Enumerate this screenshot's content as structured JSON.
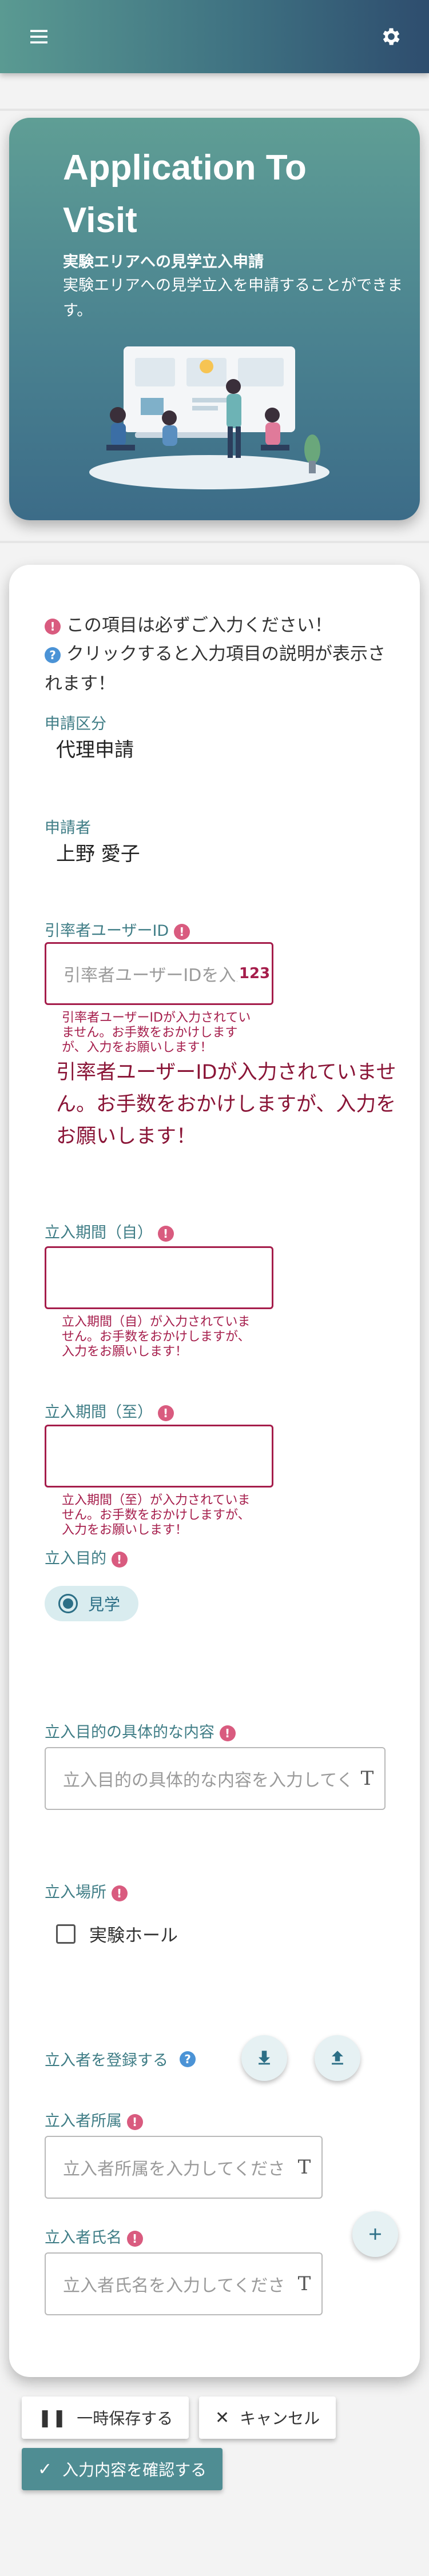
{
  "header": {
    "menu_icon": "menu-icon",
    "settings_icon": "gear-icon"
  },
  "hero": {
    "title": "Application To Visit",
    "subtitle": "実験エリアへの見学立入申請",
    "description": "実験エリアへの見学立入を申請することができます。"
  },
  "form": {
    "notes": {
      "required": "この項目は必ずご入力ください！",
      "help": "クリックすると入力項目の説明が表示されます！",
      "required_mark": "!",
      "help_mark": "?"
    },
    "application_type": {
      "label": "申請区分",
      "value": "代理申請"
    },
    "applicant": {
      "label": "申請者",
      "value": "上野 愛子"
    },
    "leader_id": {
      "label": "引率者ユーザーID",
      "placeholder": "引率者ユーザーIDを入力してください",
      "suffix": "123",
      "error_small": "引率者ユーザーIDが入力されていません。お手数をおかけしますが、入力をお願いします！",
      "error_big": "引率者ユーザーIDが入力されていません。お手数をおかけしますが、入力をお願いします！"
    },
    "period_from": {
      "label": "立入期間（自）",
      "error": "立入期間（自）が入力されていません。お手数をおかけしますが、入力をお願いします！"
    },
    "period_to": {
      "label": "立入期間（至）",
      "error": "立入期間（至）が入力されていません。お手数をおかけしますが、入力をお願いします！"
    },
    "purpose": {
      "label": "立入目的",
      "option": "見学"
    },
    "purpose_detail": {
      "label": "立入目的の具体的な内容",
      "placeholder": "立入目的の具体的な内容を入力してください"
    },
    "location": {
      "label": "立入場所",
      "option": "実験ホール"
    },
    "visitors": {
      "label": "立入者を登録する"
    },
    "visitor_org": {
      "label": "立入者所属",
      "placeholder": "立入者所属を入力してください"
    },
    "visitor_name": {
      "label": "立入者氏名",
      "placeholder": "立入者氏名を入力してください"
    },
    "text_suffix": "T"
  },
  "actions": {
    "pause": "一時保存する",
    "cancel": "キャンセル",
    "confirm": "入力内容を確認する"
  }
}
